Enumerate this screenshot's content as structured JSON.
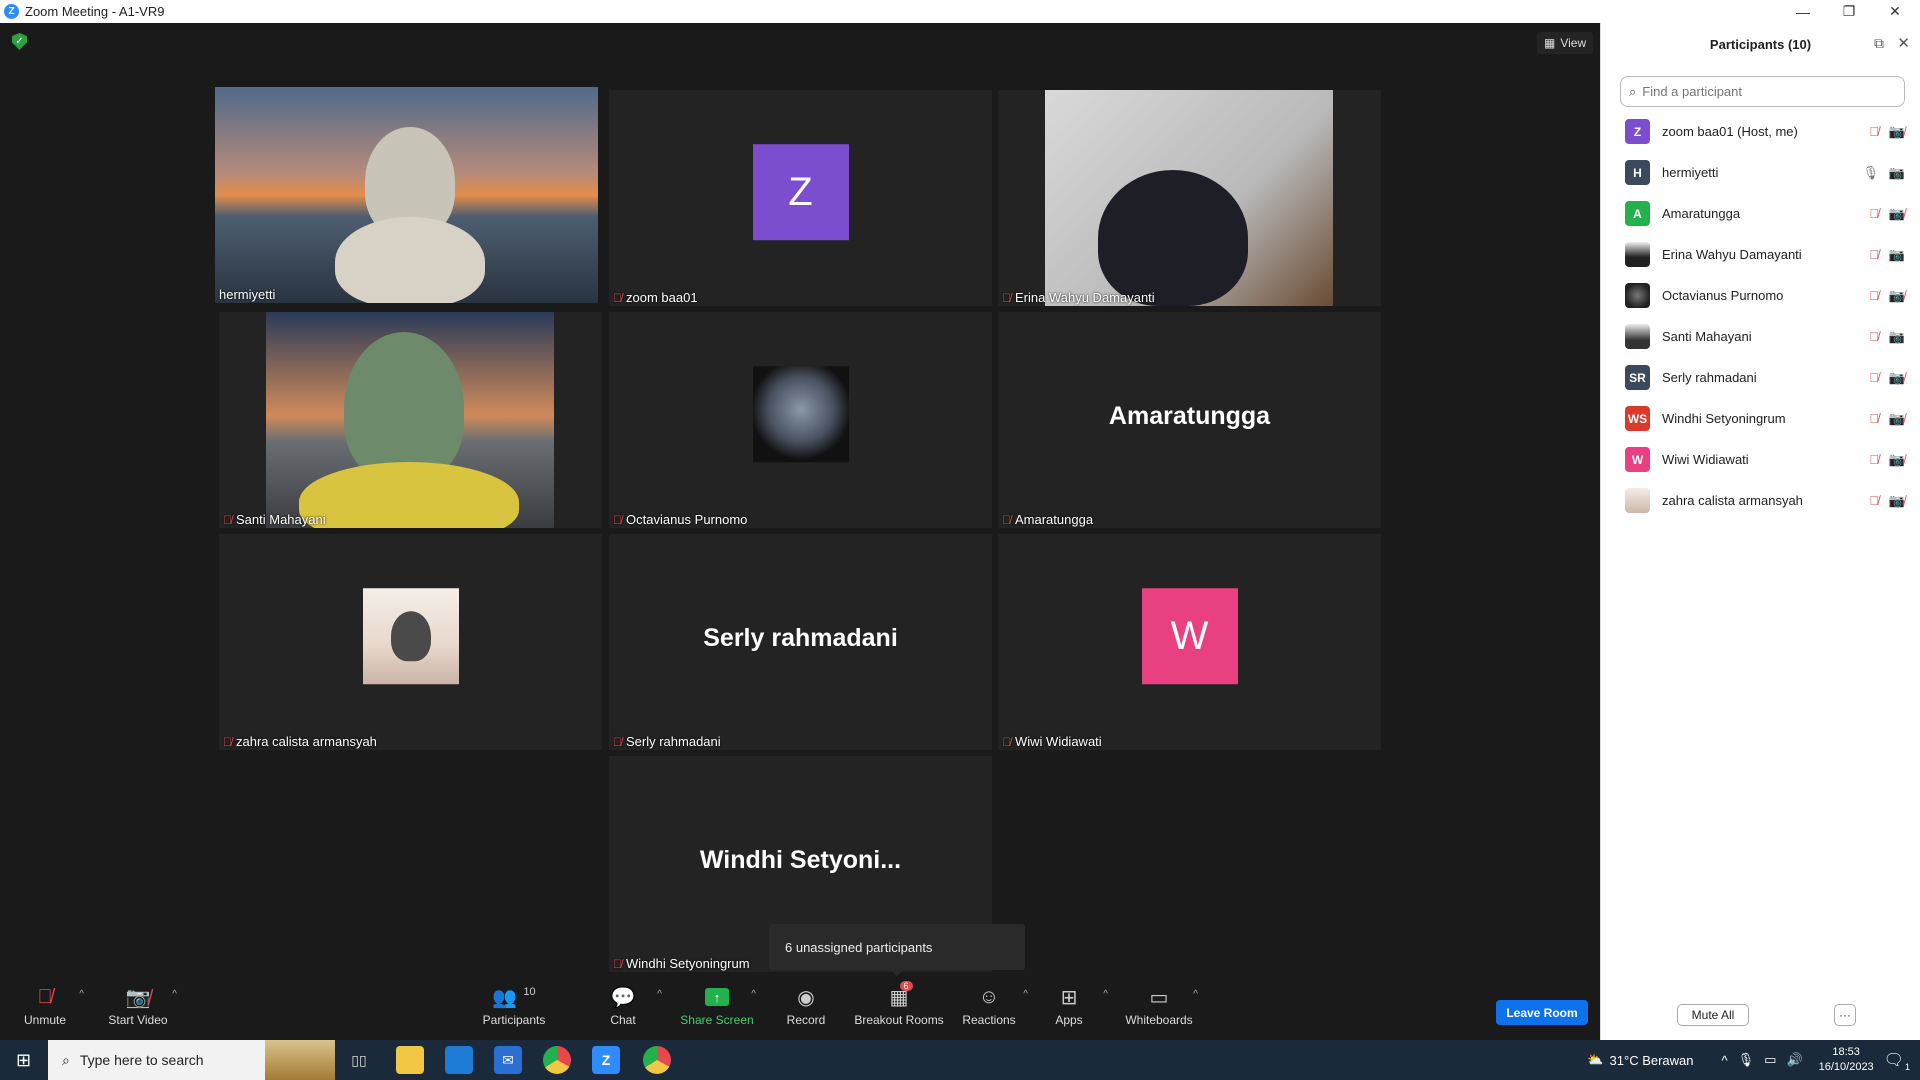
{
  "window": {
    "title": "Zoom Meeting - A1-VR9",
    "logo_letter": "Z"
  },
  "view_button": {
    "label": "View"
  },
  "tiles": [
    {
      "name": "hermiyetti",
      "muted": false,
      "bigname": "",
      "avatar_letter": ""
    },
    {
      "name": "zoom baa01",
      "muted": true,
      "bigname": "",
      "avatar_letter": "Z",
      "avatar_color": "#7c4dcf"
    },
    {
      "name": "Erina Wahyu Damayanti",
      "muted": true,
      "bigname": "",
      "avatar_letter": ""
    },
    {
      "name": "Santi Mahayani",
      "muted": true,
      "bigname": "",
      "avatar_letter": ""
    },
    {
      "name": "Octavianus Purnomo",
      "muted": true,
      "bigname": "",
      "avatar_letter": ""
    },
    {
      "name": "Amaratungga",
      "muted": true,
      "bigname": "Amaratungga",
      "avatar_letter": ""
    },
    {
      "name": "zahra calista armansyah",
      "muted": true,
      "bigname": "",
      "avatar_letter": ""
    },
    {
      "name": "Serly rahmadani",
      "muted": true,
      "bigname": "Serly rahmadani",
      "avatar_letter": ""
    },
    {
      "name": "Wiwi Widiawati",
      "muted": true,
      "bigname": "",
      "avatar_letter": "W",
      "avatar_color": "#e84080"
    },
    {
      "name": "Windhi Setyoningrum",
      "muted": true,
      "bigname": "Windhi  Setyoni...",
      "avatar_letter": ""
    }
  ],
  "tooltip": {
    "text": "6 unassigned participants"
  },
  "toolbar": {
    "unmute": "Unmute",
    "start_video": "Start Video",
    "participants": "Participants",
    "participants_count": "10",
    "chat": "Chat",
    "share_screen": "Share Screen",
    "record": "Record",
    "breakout_rooms": "Breakout Rooms",
    "breakout_badge": "6",
    "reactions": "Reactions",
    "apps": "Apps",
    "whiteboards": "Whiteboards",
    "leave_room": "Leave Room"
  },
  "panel": {
    "title": "Participants (10)",
    "search_placeholder": "Find a participant",
    "participants": [
      {
        "name": "zoom baa01 (Host, me)",
        "initials": "Z",
        "color": "#7c4dcf",
        "mic": "muted",
        "cam": "off"
      },
      {
        "name": "hermiyetti",
        "initials": "H",
        "color": "#3a4a5c",
        "mic": "on",
        "cam": "on"
      },
      {
        "name": "Amaratungga",
        "initials": "A",
        "color": "#22b14c",
        "mic": "muted",
        "cam": "off"
      },
      {
        "name": "Erina Wahyu Damayanti",
        "initials": "",
        "color": "#e6e6e6",
        "mic": "muted",
        "cam": "on"
      },
      {
        "name": "Octavianus Purnomo",
        "initials": "",
        "color": "#333333",
        "mic": "muted",
        "cam": "off"
      },
      {
        "name": "Santi Mahayani",
        "initials": "",
        "color": "#dcdcdc",
        "mic": "muted",
        "cam": "on"
      },
      {
        "name": "Serly rahmadani",
        "initials": "SR",
        "color": "#3a4a5c",
        "mic": "muted",
        "cam": "off"
      },
      {
        "name": "Windhi Setyoningrum",
        "initials": "WS",
        "color": "#d93a2b",
        "mic": "muted",
        "cam": "off"
      },
      {
        "name": "Wiwi Widiawati",
        "initials": "W",
        "color": "#e84080",
        "mic": "muted",
        "cam": "off"
      },
      {
        "name": "zahra calista armansyah",
        "initials": "",
        "color": "#f0e4dc",
        "mic": "muted",
        "cam": "off"
      }
    ],
    "mute_all": "Mute All",
    "more": "···"
  },
  "taskbar": {
    "search_placeholder": "Type here to search",
    "weather": "31°C  Berawan",
    "time": "18:53",
    "date": "16/10/2023",
    "notification_count": "1"
  }
}
